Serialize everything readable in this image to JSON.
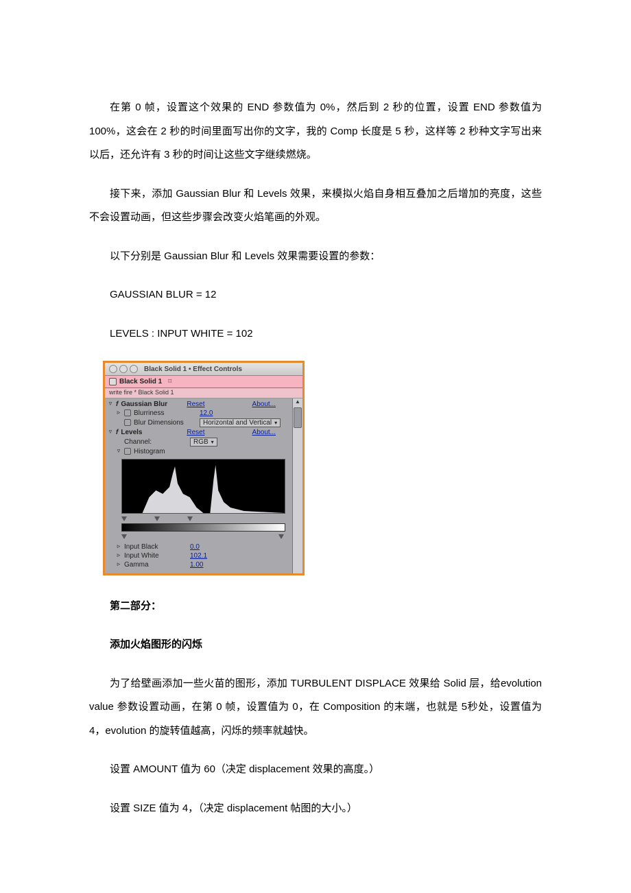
{
  "paragraphs": {
    "p1": "在第 0 帧，设置这个效果的 END 参数值为 0%，然后到 2 秒的位置，设置 END 参数值为 100%，这会在 2 秒的时间里面写出你的文字，我的 Comp 长度是 5 秒，这样等 2 秒种文字写出来以后，还允许有 3 秒的时间让这些文字继续燃烧。",
    "p2": "接下来，添加 Gaussian Blur  和  Levels 效果，来模拟火焰自身相互叠加之后增加的亮度，这些不会设置动画，但这些步骤会改变火焰笔画的外观。",
    "p3": "以下分别是 Gaussian Blur  和  Levels 效果需要设置的参数：",
    "p4": "GAUSSIAN BLUR = 12",
    "p5": "LEVELS : INPUT WHITE = 102",
    "p6": "第二部分：",
    "p7": "添加火焰图形的闪烁",
    "p8": "为了给壁画添加一些火苗的图形，添加 TURBULENT DISPLACE 效果给 Solid  层，给evolution value 参数设置动画，在第 0 帧，设置值为 0，在 Composition 的末端，也就是 5秒处，设置值为 4，evolution  的旋转值越高，闪烁的频率就越快。",
    "p9": "设置 AMOUNT 值为 60（决定 displacement 效果的高度。）",
    "p10": "设置 SIZE 值为 4，（决定 displacement 帖图的大小。）"
  },
  "panel": {
    "window_title": "Black Solid 1 • Effect Controls",
    "tab_label": "Black Solid 1",
    "subpath": "write fire * Black Solid 1",
    "effects": {
      "gblur": {
        "name": "Gaussian Blur",
        "reset": "Reset",
        "about": "About...",
        "blurriness_label": "Blurriness",
        "blurriness_value": "12.0",
        "dims_label": "Blur Dimensions",
        "dims_value": "Horizontal and Vertical"
      },
      "levels": {
        "name": "Levels",
        "reset": "Reset",
        "about": "About...",
        "channel_label": "Channel:",
        "channel_value": "RGB",
        "hist_label": "Histogram",
        "input_black_label": "Input Black",
        "input_black_value": "0.0",
        "input_white_label": "Input White",
        "input_white_value": "102.1",
        "gamma_label": "Gamma",
        "gamma_value": "1.00"
      }
    }
  }
}
